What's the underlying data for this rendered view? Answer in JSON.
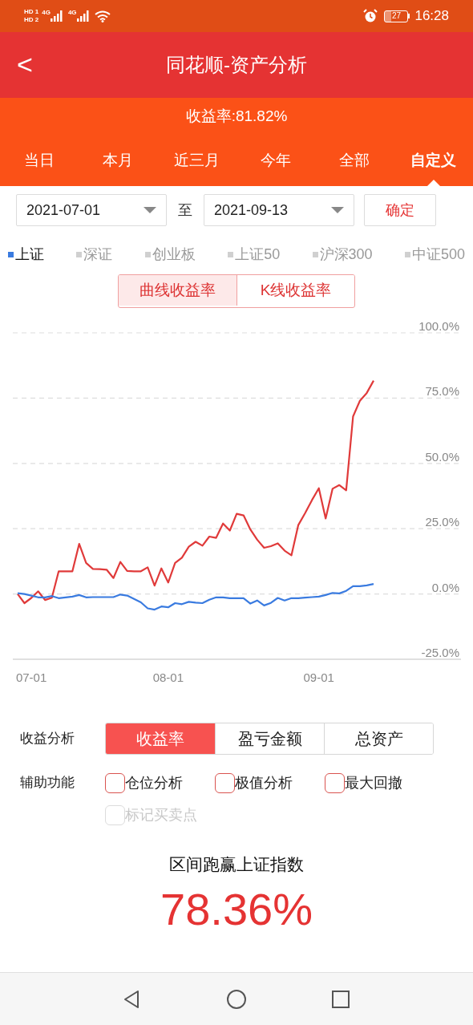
{
  "status_bar": {
    "sim_1": "HD 1",
    "sim_2": "HD 2",
    "network_1": "4G",
    "network_2": "4G",
    "battery": "27",
    "time": "16:28"
  },
  "header": {
    "back": "<",
    "title": "同花顺-资产分析"
  },
  "summary": {
    "return_rate": "收益率:81.82%"
  },
  "period_tabs": [
    {
      "label": "当日",
      "selected": false
    },
    {
      "label": "本月",
      "selected": false
    },
    {
      "label": "近三月",
      "selected": false
    },
    {
      "label": "今年",
      "selected": false
    },
    {
      "label": "全部",
      "selected": false
    },
    {
      "label": "自定义",
      "selected": true
    }
  ],
  "date_range": {
    "start": "2021-07-01",
    "separator": "至",
    "end": "2021-09-13",
    "confirm": "确定"
  },
  "indices": [
    {
      "label": "上证",
      "selected": true,
      "color": "#3a7be0"
    },
    {
      "label": "深证",
      "selected": false,
      "color": "#d0d0d0"
    },
    {
      "label": "创业板",
      "selected": false,
      "color": "#d0d0d0"
    },
    {
      "label": "上证50",
      "selected": false,
      "color": "#d0d0d0"
    },
    {
      "label": "沪深300",
      "selected": false,
      "color": "#d0d0d0"
    },
    {
      "label": "中证500",
      "selected": false,
      "color": "#d0d0d0"
    }
  ],
  "chart_modes": [
    {
      "label": "曲线收益率",
      "selected": true
    },
    {
      "label": "K线收益率",
      "selected": false
    }
  ],
  "chart": {
    "chart_data": {
      "type": "line",
      "categories": [
        null,
        null,
        "07-01",
        null,
        null,
        null,
        null,
        null,
        null,
        null,
        null,
        null,
        null,
        null,
        null,
        null,
        null,
        null,
        null,
        null,
        null,
        null,
        "08-01",
        null,
        null,
        null,
        null,
        null,
        null,
        null,
        null,
        null,
        null,
        null,
        null,
        null,
        null,
        null,
        null,
        null,
        null,
        null,
        null,
        null,
        "09-01",
        null,
        null,
        null,
        null,
        null,
        null,
        null,
        null
      ],
      "series": [
        {
          "color": "#e03a3a",
          "values": [
            0,
            -3.5,
            -1.5,
            1,
            -2.3,
            -1.4,
            8.7,
            8.7,
            8.7,
            19.2,
            11.9,
            9.6,
            9.5,
            9.3,
            6.1,
            12.3,
            8.8,
            8.7,
            8.7,
            10.2,
            3.2,
            9.8,
            4.4,
            11.9,
            13.9,
            18.1,
            20,
            18.5,
            22,
            21.5,
            27,
            24.3,
            30.7,
            30.1,
            24.7,
            20.8,
            17.7,
            18.3,
            19.4,
            16.6,
            14.8,
            26.4,
            31,
            36,
            40.5,
            28.9,
            40.3,
            41.7,
            39.7,
            68,
            74,
            77,
            81.7
          ]
        },
        {
          "color": "#3a7be0",
          "values": [
            0.3,
            0,
            -0.6,
            -1.3,
            -1.3,
            -0.8,
            -1.6,
            -1.3,
            -1.0,
            -0.4,
            -1.3,
            -1.2,
            -1.2,
            -1.2,
            -1.2,
            -0.2,
            -0.6,
            -1.9,
            -3.2,
            -5.5,
            -6.0,
            -4.8,
            -5.1,
            -3.5,
            -3.9,
            -3.0,
            -3.3,
            -3.5,
            -2.2,
            -1.3,
            -1.3,
            -1.6,
            -1.6,
            -1.6,
            -3.7,
            -2.5,
            -4.4,
            -3.4,
            -1.5,
            -2.5,
            -1.6,
            -1.6,
            -1.4,
            -1.2,
            -1.0,
            -0.4,
            0.4,
            0.2,
            1.2,
            3.0,
            3.0,
            3.3,
            3.8
          ]
        }
      ],
      "grid": true,
      "ylim": [
        -25,
        100
      ],
      "yticks": [
        {
          "value": 100,
          "label": "100.0%"
        },
        {
          "value": 75,
          "label": "75.0%"
        },
        {
          "value": 50,
          "label": "50.0%"
        },
        {
          "value": 25,
          "label": "25.0%"
        },
        {
          "value": 0,
          "label": "0.0%"
        },
        {
          "value": -25,
          "label": "-25.0%"
        }
      ]
    }
  },
  "analysis": {
    "label": "收益分析",
    "segments": [
      {
        "label": "收益率",
        "selected": true
      },
      {
        "label": "盈亏金额",
        "selected": false
      },
      {
        "label": "总资产",
        "selected": false
      }
    ]
  },
  "aux": {
    "label": "辅助功能",
    "options": [
      {
        "label": "仓位分析",
        "checked": false,
        "disabled": false
      },
      {
        "label": "极值分析",
        "checked": false,
        "disabled": false
      },
      {
        "label": "最大回撤",
        "checked": false,
        "disabled": false
      },
      {
        "label": "标记买卖点",
        "checked": false,
        "disabled": true
      }
    ]
  },
  "result": {
    "title": "区间跑赢上证指数",
    "value": "78.36%"
  }
}
